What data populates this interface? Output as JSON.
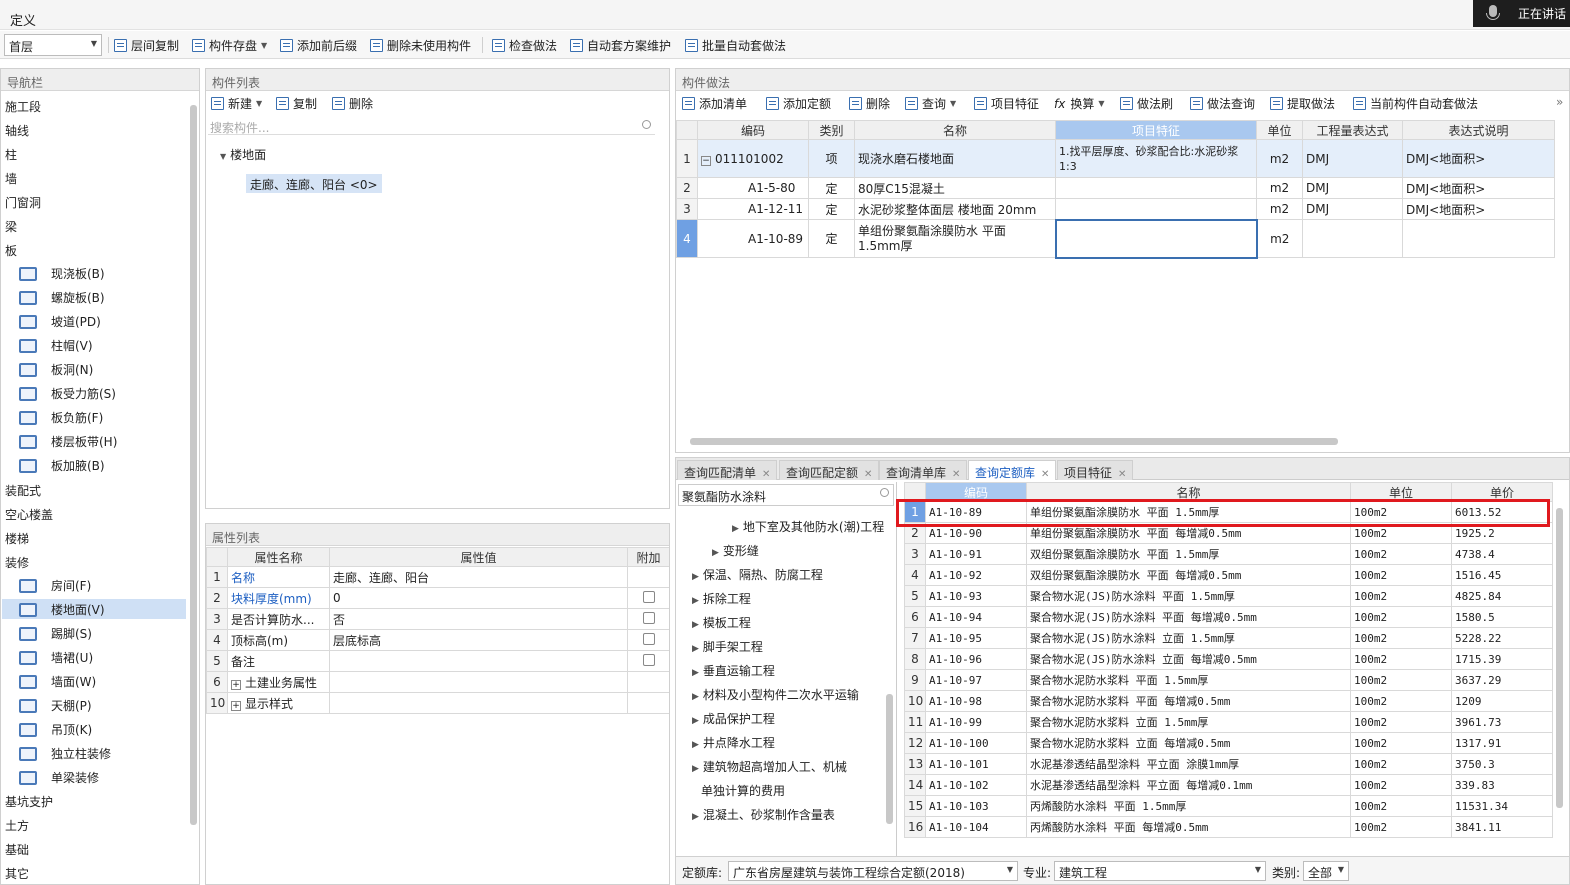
{
  "window": {
    "title": "定义",
    "speaking": "正在讲话"
  },
  "toolbar": {
    "floor": "首层",
    "buttons": [
      "层间复制",
      "构件存盘",
      "添加前后缀",
      "删除未使用构件",
      "检查做法",
      "自动套方案维护",
      "批量自动套做法"
    ]
  },
  "nav": {
    "title": "导航栏",
    "items": [
      "施工段",
      "轴线",
      "柱",
      "墙",
      "门窗洞",
      "梁",
      "板"
    ],
    "ban_sub": [
      "现浇板(B)",
      "螺旋板(B)",
      "坡道(PD)",
      "柱帽(V)",
      "板洞(N)",
      "板受力筋(S)",
      "板负筋(F)",
      "楼层板带(H)",
      "板加腋(B)"
    ],
    "items2": [
      "装配式",
      "空心楼盖",
      "楼梯",
      "装修"
    ],
    "zx_sub": [
      "房间(F)",
      "楼地面(V)",
      "踢脚(S)",
      "墙裙(U)",
      "墙面(W)",
      "天棚(P)",
      "吊顶(K)",
      "独立柱装修",
      "单梁装修"
    ],
    "items3": [
      "基坑支护",
      "土方",
      "基础",
      "其它"
    ]
  },
  "complist": {
    "title": "构件列表",
    "new": "新建",
    "copy": "复制",
    "delete": "删除",
    "search_placeholder": "搜索构件...",
    "node": "楼地面",
    "child": "走廊、连廊、阳台 <0>"
  },
  "props": {
    "title": "属性列表",
    "headers": [
      "属性名称",
      "属性值",
      "附加"
    ],
    "rows": [
      {
        "n": "1",
        "name": "名称",
        "val": "走廊、连廊、阳台"
      },
      {
        "n": "2",
        "name": "块料厚度(mm)",
        "val": "0"
      },
      {
        "n": "3",
        "name": "是否计算防水...",
        "val": "否"
      },
      {
        "n": "4",
        "name": "顶标高(m)",
        "val": "层底标高"
      },
      {
        "n": "5",
        "name": "备注",
        "val": ""
      },
      {
        "n": "6",
        "name": "土建业务属性",
        "val": ""
      },
      {
        "n": "10",
        "name": "显示样式",
        "val": ""
      }
    ]
  },
  "method": {
    "title": "构件做法",
    "toolbar": [
      "添加清单",
      "添加定额",
      "删除",
      "查询",
      "项目特征",
      "换算",
      "做法刷",
      "做法查询",
      "提取做法",
      "当前构件自动套做法"
    ],
    "headers": [
      "编码",
      "类别",
      "名称",
      "项目特征",
      "单位",
      "工程量表达式",
      "表达式说明"
    ],
    "rows": [
      {
        "n": "1",
        "code": "011101002",
        "type": "项",
        "name": "现浇水磨石楼地面",
        "feat": "1.找平层厚度、砂浆配合比:水泥砂浆1:3",
        "unit": "m2",
        "expr": "DMJ",
        "desc": "DMJ<地面积>"
      },
      {
        "n": "2",
        "code": "A1-5-80",
        "type": "定",
        "name": "80厚C15混凝土",
        "feat": "",
        "unit": "m2",
        "expr": "DMJ",
        "desc": "DMJ<地面积>"
      },
      {
        "n": "3",
        "code": "A1-12-11",
        "type": "定",
        "name": "水泥砂浆整体面层 楼地面 20mm",
        "feat": "",
        "unit": "m2",
        "expr": "DMJ",
        "desc": "DMJ<地面积>"
      },
      {
        "n": "4",
        "code": "A1-10-89",
        "type": "定",
        "name": "单组份聚氨酯涂膜防水 平面 1.5mm厚",
        "feat": "",
        "unit": "m2",
        "expr": "",
        "desc": ""
      }
    ]
  },
  "query": {
    "tabs": [
      "查询匹配清单",
      "查询匹配定额",
      "查询清单库",
      "查询定额库",
      "项目特征"
    ],
    "search": "聚氨酯防水涂料",
    "tree": [
      "地下室及其他防水(潮)工程",
      "变形缝",
      "保温、隔热、防腐工程",
      "拆除工程",
      "模板工程",
      "脚手架工程",
      "垂直运输工程",
      "材料及小型构件二次水平运输",
      "成品保护工程",
      "井点降水工程",
      "建筑物超高增加人工、机械",
      "单独计算的费用",
      "混凝土、砂浆制作含量表"
    ],
    "headers": [
      "编码",
      "名称",
      "单位",
      "单价"
    ],
    "rows": [
      [
        "1",
        "A1-10-89",
        "单组份聚氨酯涂膜防水 平面 1.5mm厚",
        "100m2",
        "6013.52"
      ],
      [
        "2",
        "A1-10-90",
        "单组份聚氨酯涂膜防水 平面 每增减0.5mm",
        "100m2",
        "1925.2"
      ],
      [
        "3",
        "A1-10-91",
        "双组份聚氨酯涂膜防水 平面 1.5mm厚",
        "100m2",
        "4738.4"
      ],
      [
        "4",
        "A1-10-92",
        "双组份聚氨酯涂膜防水 平面 每增减0.5mm",
        "100m2",
        "1516.45"
      ],
      [
        "5",
        "A1-10-93",
        "聚合物水泥(JS)防水涂料 平面 1.5mm厚",
        "100m2",
        "4825.84"
      ],
      [
        "6",
        "A1-10-94",
        "聚合物水泥(JS)防水涂料 平面 每增减0.5mm",
        "100m2",
        "1580.5"
      ],
      [
        "7",
        "A1-10-95",
        "聚合物水泥(JS)防水涂料 立面 1.5mm厚",
        "100m2",
        "5228.22"
      ],
      [
        "8",
        "A1-10-96",
        "聚合物水泥(JS)防水涂料 立面 每增减0.5mm",
        "100m2",
        "1715.39"
      ],
      [
        "9",
        "A1-10-97",
        "聚合物水泥防水浆料 平面 1.5mm厚",
        "100m2",
        "3637.29"
      ],
      [
        "10",
        "A1-10-98",
        "聚合物水泥防水浆料 平面 每增减0.5mm",
        "100m2",
        "1209"
      ],
      [
        "11",
        "A1-10-99",
        "聚合物水泥防水浆料 立面 1.5mm厚",
        "100m2",
        "3961.73"
      ],
      [
        "12",
        "A1-10-100",
        "聚合物水泥防水浆料 立面 每增减0.5mm",
        "100m2",
        "1317.91"
      ],
      [
        "13",
        "A1-10-101",
        "水泥基渗透结晶型涂料 平立面 涂膜1mm厚",
        "100m2",
        "3750.3"
      ],
      [
        "14",
        "A1-10-102",
        "水泥基渗透结晶型涂料 平立面 每增减0.1mm",
        "100m2",
        "339.83"
      ],
      [
        "15",
        "A1-10-103",
        "丙烯酸防水涂料 平面 1.5mm厚",
        "100m2",
        "11531.34"
      ],
      [
        "16",
        "A1-10-104",
        "丙烯酸防水涂料 平面 每增减0.5mm",
        "100m2",
        "3841.11"
      ]
    ],
    "footer": {
      "lib_label": "定额库:",
      "lib": "广东省房屋建筑与装饰工程综合定额(2018)",
      "spec_label": "专业:",
      "spec": "建筑工程",
      "cat_label": "类别:",
      "cat": "全部"
    }
  },
  "colors": {
    "accent": "#1d5fc2",
    "highlight": "#e0191e",
    "selected": "#cfe0f5"
  }
}
